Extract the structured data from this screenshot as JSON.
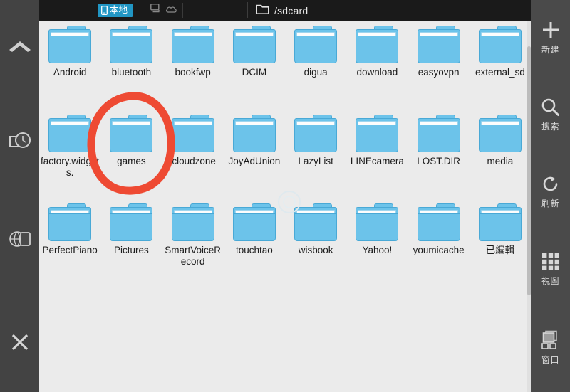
{
  "window": {
    "background_color": "#1a1a1a",
    "content_background": "#ebebeb"
  },
  "topbar": {
    "local_tab_label": "本地",
    "local_tab_color": "#2196c4",
    "local_tab_icon": "phone-icon",
    "pc_icon": "computer-icon",
    "cloud_icon": "cloud-icon",
    "path_icon": "folder-icon",
    "path": "/sdcard"
  },
  "sidebar_left": {
    "items": [
      {
        "name": "collapse",
        "icon": "chevron-up-icon"
      },
      {
        "name": "history",
        "icon": "clock-icon"
      },
      {
        "name": "browser",
        "icon": "globe-icon"
      },
      {
        "name": "close",
        "icon": "close-icon"
      }
    ]
  },
  "sidebar_right": {
    "items": [
      {
        "name": "new",
        "label": "新建",
        "icon": "plus-icon"
      },
      {
        "name": "search",
        "label": "搜索",
        "icon": "search-icon"
      },
      {
        "name": "refresh",
        "label": "刷新",
        "icon": "refresh-icon"
      },
      {
        "name": "view",
        "label": "視圖",
        "icon": "grid-icon"
      },
      {
        "name": "window",
        "label": "窗口",
        "icon": "windows-icon"
      }
    ]
  },
  "files": {
    "icon_body_color": "#6cc3ea",
    "icon_outline_color": "#49a9d6",
    "items": [
      {
        "label": "Android"
      },
      {
        "label": "bluetooth"
      },
      {
        "label": "bookfwp"
      },
      {
        "label": "DCIM"
      },
      {
        "label": "digua"
      },
      {
        "label": "download"
      },
      {
        "label": "easyovpn"
      },
      {
        "label": "external_sd"
      },
      {
        "label": "factory.widgets."
      },
      {
        "label": "games"
      },
      {
        "label": "icloudzone"
      },
      {
        "label": "JoyAdUnion"
      },
      {
        "label": "LazyList"
      },
      {
        "label": "LINEcamera"
      },
      {
        "label": "LOST.DIR"
      },
      {
        "label": "media"
      },
      {
        "label": "PerfectPiano"
      },
      {
        "label": "Pictures"
      },
      {
        "label": "SmartVoiceRecord"
      },
      {
        "label": "touchtao"
      },
      {
        "label": "wisbook"
      },
      {
        "label": "Yahoo!"
      },
      {
        "label": "youmicache"
      },
      {
        "label": "已編輯"
      }
    ]
  },
  "annotation": {
    "type": "hand-drawn-circle",
    "color": "#ee4a33",
    "targets_item": "games"
  }
}
